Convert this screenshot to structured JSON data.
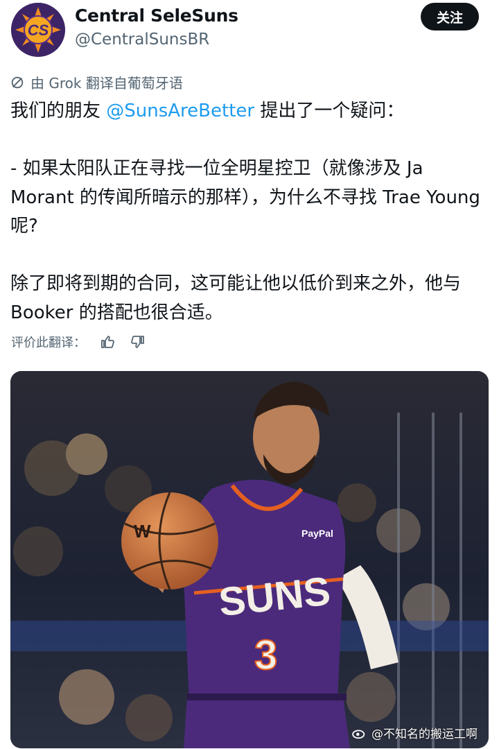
{
  "author": {
    "display_name": "Central SeleSuns",
    "handle": "@CentralSunsBR",
    "avatar_text": "CS"
  },
  "follow_button": {
    "label": "关注"
  },
  "translation_note": "由 Grok 翻译自葡萄牙语",
  "tweet": {
    "line1_prefix": "我们的朋友 ",
    "mention": "@SunsAreBetter",
    "line1_suffix": " 提出了一个疑问：",
    "para2": "- 如果太阳队正在寻找一位全明星控卫（就像涉及 Ja Morant 的传闻所暗示的那样），为什么不寻找 Trae Young 呢?",
    "para3": "除了即将到期的合同，这可能让他以低价到来之外，他与 Booker 的搭配也很合适。"
  },
  "rate_translation": {
    "label": "评价此翻译："
  },
  "photo": {
    "jersey_text": "SUNS",
    "jersey_number": "3",
    "sponsor_patch": "PayPal",
    "ball_brand": "W"
  },
  "watermark": "@不知名的搬运工啊",
  "colors": {
    "link": "#1d9bf0",
    "secondary_text": "#536471",
    "jersey_purple": "#4b2a7b",
    "jersey_orange": "#e56020"
  }
}
